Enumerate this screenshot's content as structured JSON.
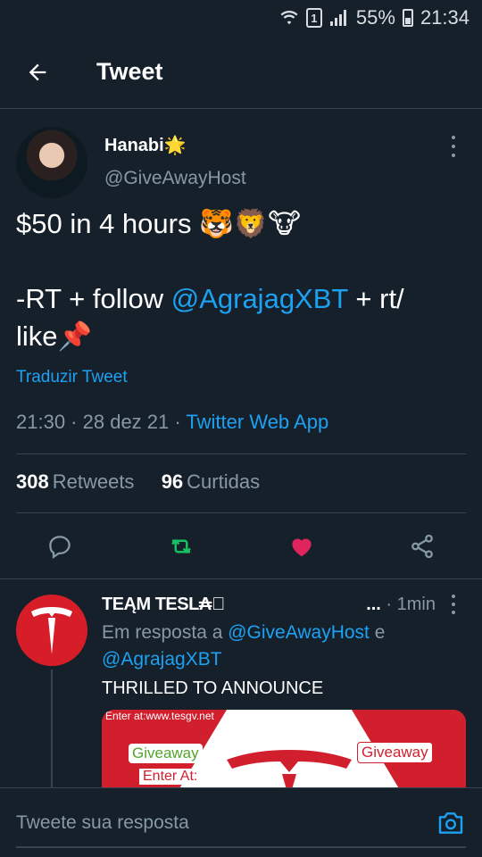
{
  "status_bar": {
    "battery": "55%",
    "time": "21:34",
    "sim": "1"
  },
  "header": {
    "title": "Tweet"
  },
  "tweet": {
    "author_name": "Hanabi🌟",
    "author_handle": "@GiveAwayHost",
    "text_line1": "$50 in 4 hours 🐯🦁🐮",
    "text_line2": "-RT + follow ",
    "mention": "@AgrajagXBT",
    "text_line2_end": " + rt/",
    "text_line3": "like📌",
    "translate": "Traduzir Tweet",
    "time": "21:30",
    "date": "28 dez 21",
    "source": "Twitter Web App",
    "retweets_count": "308",
    "retweets_label": "Retweets",
    "likes_count": "96",
    "likes_label": "Curtidas"
  },
  "reply": {
    "author_name": "TEĄM TESL₳⃠",
    "ellipsis": "...",
    "time": "1min",
    "reply_prefix": "Em resposta a ",
    "mention1": "@GiveAwayHost",
    "conj": " e",
    "mention2": "@AgrajagXBT",
    "text": "THRILLED TO ANNOUNCE",
    "media": {
      "url_text": "Enter at:www.tesgv.net",
      "giveaway_left": "Giveaway",
      "giveaway_right": "Giveaway",
      "enter_at": "Enter At:"
    }
  },
  "compose": {
    "placeholder": "Tweete sua resposta"
  },
  "colors": {
    "background": "#15202b",
    "accent": "#1da1f2",
    "like": "#e0245e",
    "retweet": "#17bf63",
    "muted": "#8899a6"
  }
}
